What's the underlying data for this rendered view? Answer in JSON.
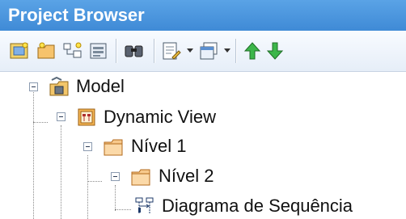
{
  "window": {
    "title": "Project Browser"
  },
  "toolbar": {
    "buttons": [
      {
        "icon": "new-model-icon"
      },
      {
        "icon": "new-package-icon"
      },
      {
        "icon": "new-diagram-icon"
      },
      {
        "icon": "new-element-icon"
      },
      {
        "icon": "find-icon"
      },
      {
        "icon": "properties-icon"
      },
      {
        "icon": "view-options-icon"
      },
      {
        "icon": "move-up-icon"
      },
      {
        "icon": "move-down-icon"
      }
    ]
  },
  "tree": {
    "nodes": [
      {
        "label": "Model",
        "icon": "model-root-icon",
        "level": 0,
        "expanded": true
      },
      {
        "label": "Dynamic View",
        "icon": "view-icon",
        "level": 1,
        "expanded": true
      },
      {
        "label": "Nível 1",
        "icon": "package-folder-icon",
        "level": 2,
        "expanded": true
      },
      {
        "label": "Nível 2",
        "icon": "package-folder-icon",
        "level": 3,
        "expanded": true
      },
      {
        "label": "Diagrama de Sequência",
        "icon": "sequence-diagram-icon",
        "level": 4,
        "expanded": false
      }
    ]
  }
}
